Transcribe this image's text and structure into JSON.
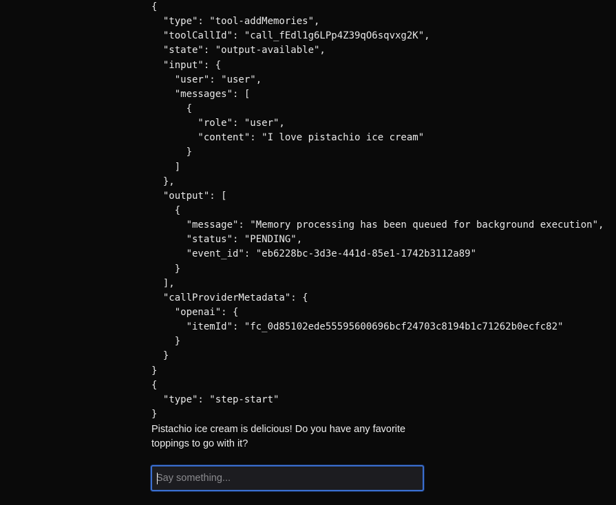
{
  "json_lines": [
    "{",
    "  \"type\": \"tool-addMemories\",",
    "  \"toolCallId\": \"call_fEdl1g6LPp4Z39qO6sqvxg2K\",",
    "  \"state\": \"output-available\",",
    "  \"input\": {",
    "    \"user\": \"user\",",
    "    \"messages\": [",
    "      {",
    "        \"role\": \"user\",",
    "        \"content\": \"I love pistachio ice cream\"",
    "      }",
    "    ]",
    "  },",
    "  \"output\": [",
    "    {",
    "      \"message\": \"Memory processing has been queued for background execution\",",
    "      \"status\": \"PENDING\",",
    "      \"event_id\": \"eb6228bc-3d3e-441d-85e1-1742b3112a89\"",
    "    }",
    "  ],",
    "  \"callProviderMetadata\": {",
    "    \"openai\": {",
    "      \"itemId\": \"fc_0d85102ede55595600696bcf24703c8194b1c71262b0ecfc82\"",
    "    }",
    "  }",
    "}",
    "{",
    "  \"type\": \"step-start\"",
    "}"
  ],
  "assistant_reply": "Pistachio ice cream is delicious! Do you have any favorite toppings to go with it?",
  "chat_input": {
    "value": "",
    "placeholder": "Say something..."
  },
  "colors": {
    "background": "#0a0a0a",
    "text": "#e8e8e8",
    "input_border": "#3b6fd0",
    "input_background": "#1c1c20",
    "placeholder": "#8a8a8e"
  }
}
